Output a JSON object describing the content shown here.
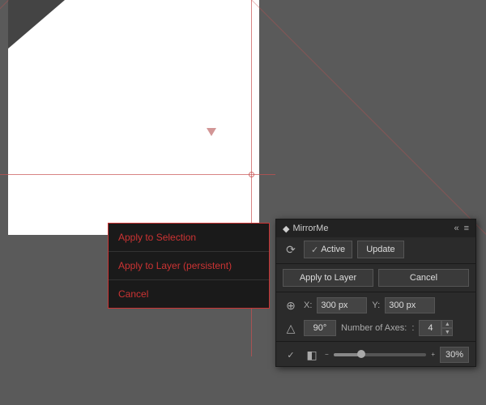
{
  "canvas": {
    "background": "#5a5a5a"
  },
  "context_menu": {
    "items": [
      {
        "id": "apply-selection",
        "label": "Apply to Selection"
      },
      {
        "id": "apply-layer-persistent",
        "label": "Apply to Layer (persistent)"
      },
      {
        "id": "cancel",
        "label": "Cancel"
      }
    ]
  },
  "mirror_panel": {
    "title": "MirrorMe",
    "title_icon": "◆",
    "controls": {
      "collapse": "«",
      "menu": "≡",
      "close": "×"
    },
    "active_label": "Active",
    "active_checked": true,
    "update_label": "Update",
    "apply_layer_label": "Apply to Layer",
    "cancel_label": "Cancel",
    "x_label": "X:",
    "x_value": "300 px",
    "y_label": "Y:",
    "y_value": "300 px",
    "angle_value": "90°",
    "axes_label": "Number of Axes:",
    "axes_value": "4",
    "opacity_value": "30%"
  }
}
